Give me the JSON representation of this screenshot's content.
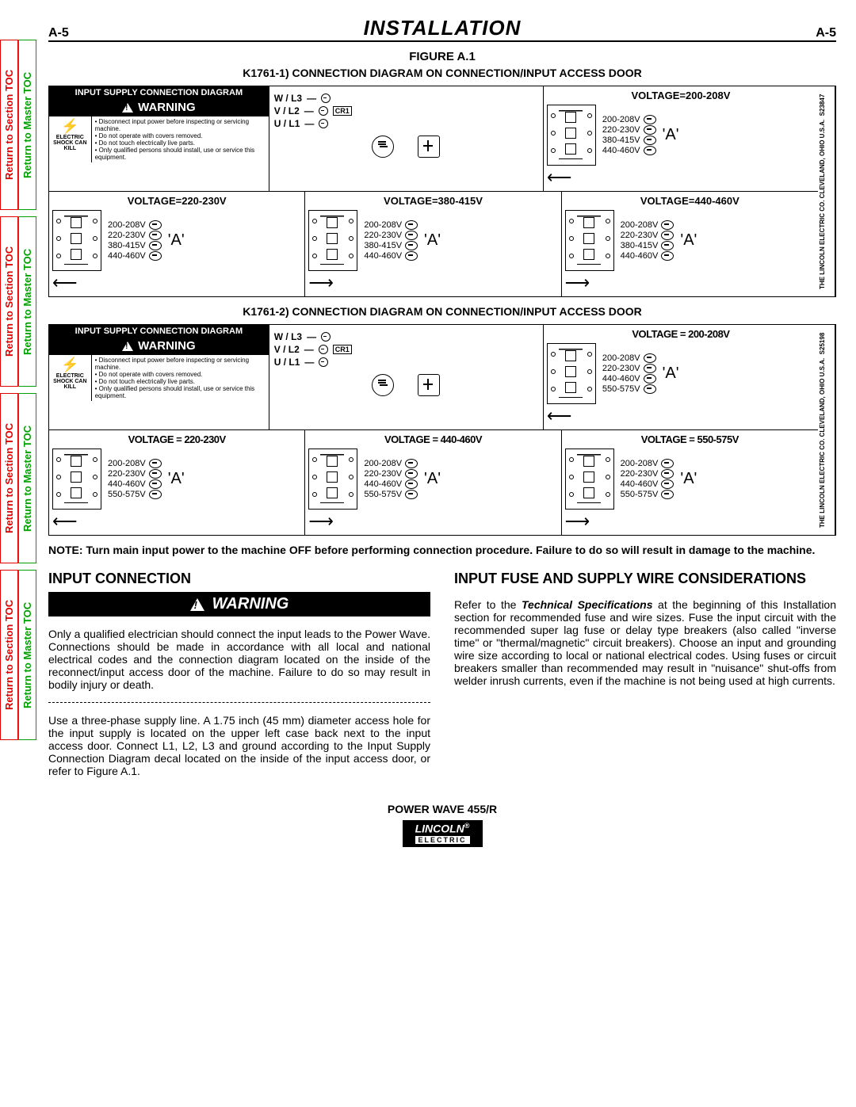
{
  "page": {
    "left": "A-5",
    "right": "A-5",
    "title": "INSTALLATION"
  },
  "tabs": {
    "section": "Return to Section TOC",
    "master": "Return to Master TOC"
  },
  "figure": {
    "title": "FIGURE A.1",
    "sub1": "K1761-1) CONNECTION DIAGRAM ON CONNECTION/INPUT ACCESS DOOR",
    "sub2": "K1761-2) CONNECTION DIAGRAM ON CONNECTION/INPUT ACCESS DOOR"
  },
  "warning": {
    "header": "INPUT SUPPLY CONNECTION DIAGRAM",
    "label": "WARNING",
    "shock": "ELECTRIC SHOCK CAN KILL",
    "items": [
      "Disconnect input power before inspecting or servicing machine.",
      "Do not operate with covers removed.",
      "Do not touch electrically live parts.",
      "Only qualified persons should install, use or service this equipment."
    ]
  },
  "terminals": {
    "l3": "W / L3",
    "l2": "V / L2",
    "l1": "U / L1",
    "cr1": "CR1"
  },
  "diag1": {
    "top_right_title": "VOLTAGE=200-208V",
    "voltages": [
      "200-208V",
      "220-230V",
      "380-415V",
      "440-460V"
    ],
    "cells": [
      {
        "title": "VOLTAGE=220-230V"
      },
      {
        "title": "VOLTAGE=380-415V"
      },
      {
        "title": "VOLTAGE=440-460V"
      }
    ],
    "company": "THE LINCOLN ELECTRIC CO.   CLEVELAND, OHIO   U.S.A.",
    "code": "S23847"
  },
  "diag2": {
    "top_right_title": "VOLTAGE = 200-208V",
    "voltages": [
      "200-208V",
      "220-230V",
      "440-460V",
      "550-575V"
    ],
    "cells": [
      {
        "title": "VOLTAGE = 220-230V"
      },
      {
        "title": "VOLTAGE = 440-460V"
      },
      {
        "title": "VOLTAGE = 550-575V"
      }
    ],
    "company": "THE LINCOLN ELECTRIC CO.   CLEVELAND, OHIO   U.S.A.",
    "code": "S25198"
  },
  "a_mark": "'A'",
  "note": "NOTE: Turn main input power to the machine OFF before performing connection procedure. Failure to do so will result in damage to the machine.",
  "sections": {
    "left_title": "INPUT CONNECTION",
    "left_warn": "WARNING",
    "left_p1": "Only a qualified electrician should connect the input leads to the Power Wave. Connections should be made in accordance with all local and national electrical codes and the connection diagram located on the inside of the reconnect/input access door of the machine. Failure to do so may result in bodily injury or death.",
    "left_p2": "Use a three-phase supply line. A 1.75 inch (45 mm) diameter access hole for the input supply is located on the upper left case back next to the input access door. Connect L1, L2, L3 and ground according to the Input Supply Connection Diagram decal located on the inside of the input access door, or refer to Figure A.1.",
    "right_title": "INPUT FUSE AND SUPPLY WIRE CONSIDERATIONS",
    "right_p1_a": "Refer to the ",
    "right_p1_b": "Technical Specifications",
    "right_p1_c": " at the beginning of this Installation section for recommended fuse and wire sizes.  Fuse the input circuit with the recommended super lag fuse or delay type breakers (also called \"inverse time\" or \"thermal/magnetic\" circuit breakers). Choose an input and grounding wire size according to local or national electrical codes.  Using fuses or circuit breakers smaller than recommended may result in \"nuisance\" shut-offs from welder inrush currents, even if the machine is not being used at high currents."
  },
  "footer": {
    "model": "POWER WAVE 455/R",
    "brand": "LINCOLN",
    "sub": "ELECTRIC"
  }
}
